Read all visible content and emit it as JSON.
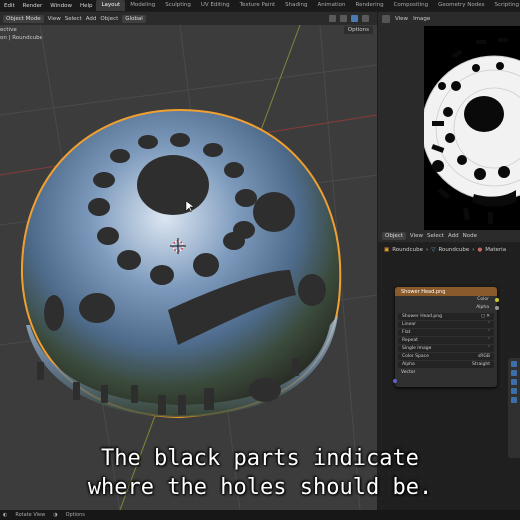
{
  "topbar": {
    "menus": [
      "Edit",
      "Render",
      "Window",
      "Help"
    ],
    "workspaces": [
      "Layout",
      "Modeling",
      "Sculpting",
      "UV Editing",
      "Texture Paint",
      "Shading",
      "Animation",
      "Rendering",
      "Compositing",
      "Geometry Nodes",
      "Scripting"
    ],
    "active_workspace": "Layout"
  },
  "viewport": {
    "mode": "Object Mode",
    "menus": [
      "View",
      "Select",
      "Add",
      "Object"
    ],
    "orientation": "Global",
    "options_label": "Options",
    "overlay_lines": [
      "ective",
      "on | Roundcube"
    ],
    "colors": {
      "background": "#3c3c3c",
      "selection_outline": "#f0a030"
    }
  },
  "image_editor": {
    "menus": [
      "View",
      "Image"
    ]
  },
  "node_editor": {
    "type": "Object",
    "menus": [
      "View",
      "Select",
      "Add",
      "Node"
    ],
    "breadcrumb": [
      "Roundcube",
      "Roundcube",
      "Materia"
    ],
    "node": {
      "title": "Shower Head.png",
      "outputs": [
        "Color",
        "Alpha"
      ],
      "image_name": "Shower Head.png",
      "fields": [
        {
          "label": "Linear",
          "value": ""
        },
        {
          "label": "Flat",
          "value": ""
        },
        {
          "label": "Repeat",
          "value": ""
        },
        {
          "label": "Single Image",
          "value": ""
        },
        {
          "label": "Color Space",
          "value": "sRGB"
        },
        {
          "label": "Alpha",
          "value": "Straight"
        }
      ],
      "input": "Vector"
    }
  },
  "statusbar": {
    "items": [
      "Rotate View",
      "Options"
    ]
  },
  "subtitle": {
    "line1": "The black parts indicate",
    "line2": "where the holes should be."
  }
}
